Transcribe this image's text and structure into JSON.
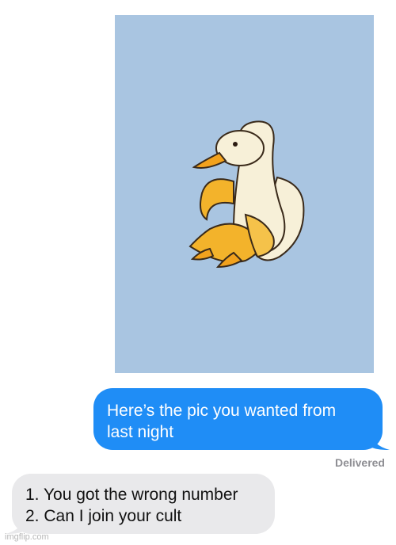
{
  "image_message": {
    "subject": "illustration of a white duck emerging from a peeled banana",
    "background_color": "#a9c5e1"
  },
  "sent_message": {
    "line1": "Here’s the pic you wanted from",
    "line2": "last night",
    "bubble_color": "#1f8df6"
  },
  "status": {
    "delivered": "Delivered"
  },
  "received_message": {
    "line1": "1. You got the wrong number",
    "line2": "2. Can I join your cult",
    "bubble_color": "#e9e9eb"
  },
  "watermark": "imgflip.com"
}
